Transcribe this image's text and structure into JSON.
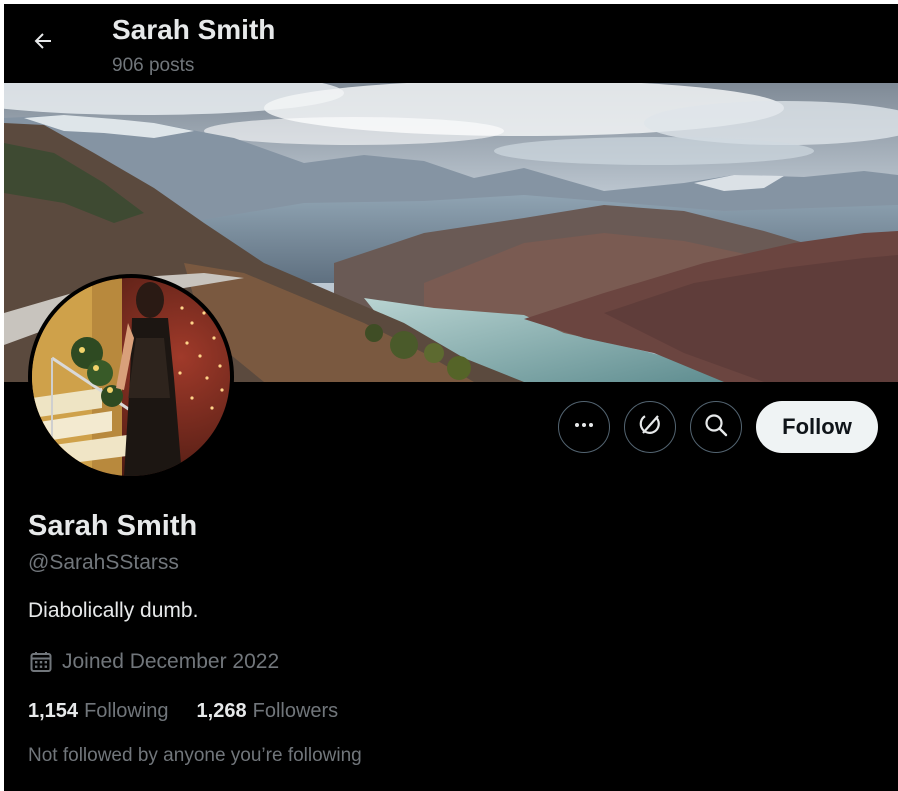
{
  "header": {
    "name": "Sarah Smith",
    "posts": "906 posts",
    "back_icon": "arrow-left-icon"
  },
  "banner": {
    "kind": "mountain-lake-landscape-photo"
  },
  "avatar": {
    "kind": "profile-photo-woman-on-stairs"
  },
  "actions": {
    "more_icon": "ellipsis-icon",
    "grok_icon": "grok-icon",
    "search_icon": "search-icon",
    "follow_label": "Follow"
  },
  "profile": {
    "display_name": "Sarah Smith",
    "handle": "@SarahSStarss",
    "bio": "Diabolically dumb.",
    "joined": "Joined December 2022",
    "joined_icon": "calendar-icon",
    "following_count": "1,154",
    "following_label": "Following",
    "followers_count": "1,268",
    "followers_label": "Followers",
    "not_followed_text": "Not followed by anyone you’re following"
  },
  "colors": {
    "background": "#000000",
    "primary_text": "#e7e9ea",
    "secondary_text": "#71767b",
    "follow_button_bg": "#eff3f4",
    "border": "#536471"
  }
}
